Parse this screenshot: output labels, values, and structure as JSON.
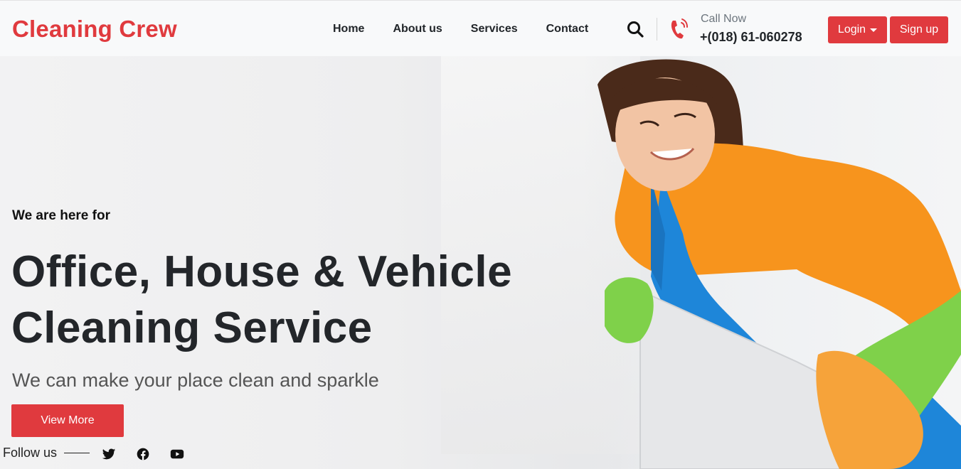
{
  "header": {
    "brand": "Cleaning Crew",
    "nav": [
      "Home",
      "About us",
      "Services",
      "Contact"
    ],
    "call_label": "Call Now",
    "call_number": "+(018) 61-060278",
    "login_label": "Login",
    "signup_label": "Sign up"
  },
  "hero": {
    "kicker": "We are here for",
    "title_line1": "Office, House & Vehicle",
    "title_line2": "Cleaning Service",
    "subtitle": "We can make your place clean and sparkle",
    "cta_label": "View More"
  },
  "footer": {
    "follow_label": "Follow us",
    "social_icons": [
      "twitter-icon",
      "facebook-icon",
      "youtube-icon"
    ]
  },
  "colors": {
    "accent": "#e03a3e",
    "text_dark": "#212529"
  }
}
